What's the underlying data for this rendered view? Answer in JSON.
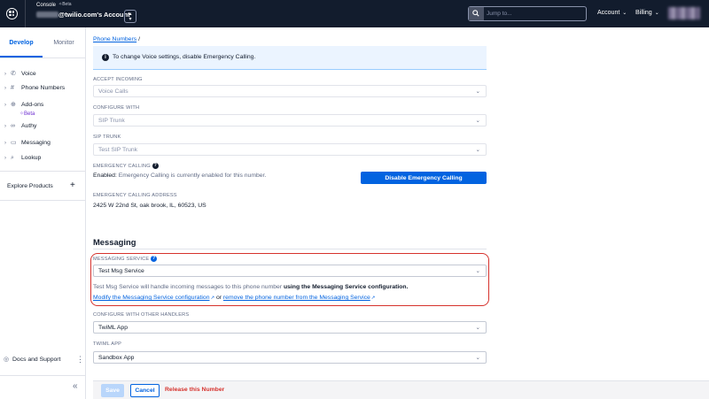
{
  "topbar": {
    "console": "Console",
    "beta": "Beta",
    "account_name": "@twilio.com's Account",
    "account_switch_icon": "chevron-up-down-icon",
    "search_placeholder": "Jump to...",
    "nav_account": "Account",
    "nav_billing": "Billing"
  },
  "sidebar": {
    "tabs": [
      {
        "label": "Develop",
        "active": true
      },
      {
        "label": "Monitor",
        "active": false
      }
    ],
    "items": [
      {
        "label": "Voice",
        "icon": "phone-icon"
      },
      {
        "label": "Phone Numbers",
        "icon": "hash-icon"
      },
      {
        "label": "Add-ons",
        "icon": "add-ons-icon",
        "badge": "Beta"
      },
      {
        "label": "Authy",
        "icon": "authy-icon"
      },
      {
        "label": "Messaging",
        "icon": "chat-icon"
      },
      {
        "label": "Lookup",
        "icon": "search-icon"
      }
    ],
    "explore": "Explore Products",
    "docs": "Docs and Support"
  },
  "main": {
    "breadcrumb": "Phone Numbers",
    "info_banner": "To change Voice settings, disable Emergency Calling.",
    "accept_incoming_label": "ACCEPT INCOMING",
    "accept_incoming_value": "Voice Calls",
    "configure_with_label": "CONFIGURE WITH",
    "configure_with_value": "SIP Trunk",
    "sip_trunk_label": "SIP TRUNK",
    "sip_trunk_value": "Test SIP Trunk",
    "emergency_label": "EMERGENCY CALLING",
    "emergency_status_prefix": "Enabled:",
    "emergency_status_text": "Emergency Calling is currently enabled for this number.",
    "disable_button": "Disable Emergency Calling",
    "emergency_address_label": "EMERGENCY CALLING ADDRESS",
    "emergency_address": "2425 W 22nd St, oak brook, IL, 60523, US",
    "messaging_heading": "Messaging",
    "messaging_service_label": "MESSAGING SERVICE",
    "messaging_service_value": "Test Msg Service",
    "messaging_desc_prefix": "Test Msg Service will handle incoming messages to this phone number",
    "messaging_desc_bold": "using the Messaging Service configuration.",
    "modify_link": "Modify the Messaging Service configuration",
    "or_text": "or",
    "remove_link": "remove the phone number from the Messaging Service",
    "other_handlers_label": "CONFIGURE WITH OTHER HANDLERS",
    "other_handlers_value": "TwiML App",
    "twiml_app_label": "TWIML APP",
    "twiml_app_value": "Sandbox App"
  },
  "footer": {
    "save": "Save",
    "cancel": "Cancel",
    "release": "Release this Number"
  },
  "colors": {
    "topbar": "#121c2d",
    "brand_blue": "#0263e0",
    "danger": "#d6322d",
    "info_bg": "#ebf4ff"
  }
}
